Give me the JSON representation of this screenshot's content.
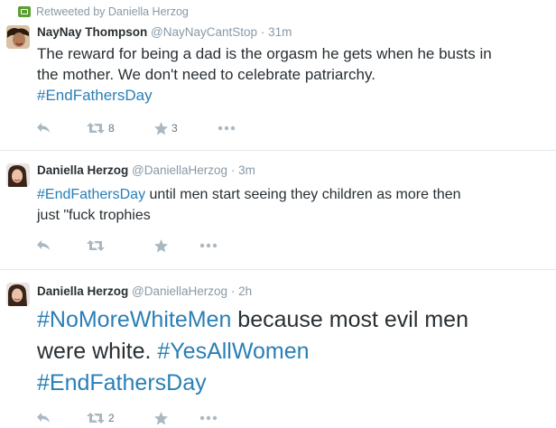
{
  "tweets": [
    {
      "retweet_context": "Retweeted by Daniella Herzog",
      "name": "NayNay Thompson",
      "handle": "@NayNayCantStop",
      "separator": "·",
      "time": "31m",
      "text_line1": "The reward for being a dad is the orgasm he gets when he busts in",
      "text_line2": "the mother. We don't need to celebrate patriarchy.",
      "hashtag1": "#EndFathersDay",
      "retweets": "8",
      "favorites": "3"
    },
    {
      "name": "Daniella Herzog",
      "handle": "@DaniellaHerzog",
      "separator": "·",
      "time": "3m",
      "hashtag1": "#EndFathersDay",
      "text_line1_rest": " until men start seeing they children as more then",
      "text_line2": "just \"fuck trophies"
    },
    {
      "name": "Daniella Herzog",
      "handle": "@DaniellaHerzog",
      "separator": "·",
      "time": "2h",
      "hashtag1": "#NoMoreWhiteMen",
      "text_mid": " because most evil men",
      "text_line2": "were white. ",
      "hashtag2": "#YesAllWomen",
      "hashtag3": "#EndFathersDay",
      "retweets": "2"
    }
  ],
  "colors": {
    "hashtag": "#2a7fb6",
    "retweet_badge": "#5c9e31",
    "secondary": "#8899a6",
    "icon": "#aab8c2"
  },
  "icons": [
    "retweet-badge-icon",
    "reply-icon",
    "retweet-icon",
    "favorite-icon",
    "more-icon"
  ]
}
